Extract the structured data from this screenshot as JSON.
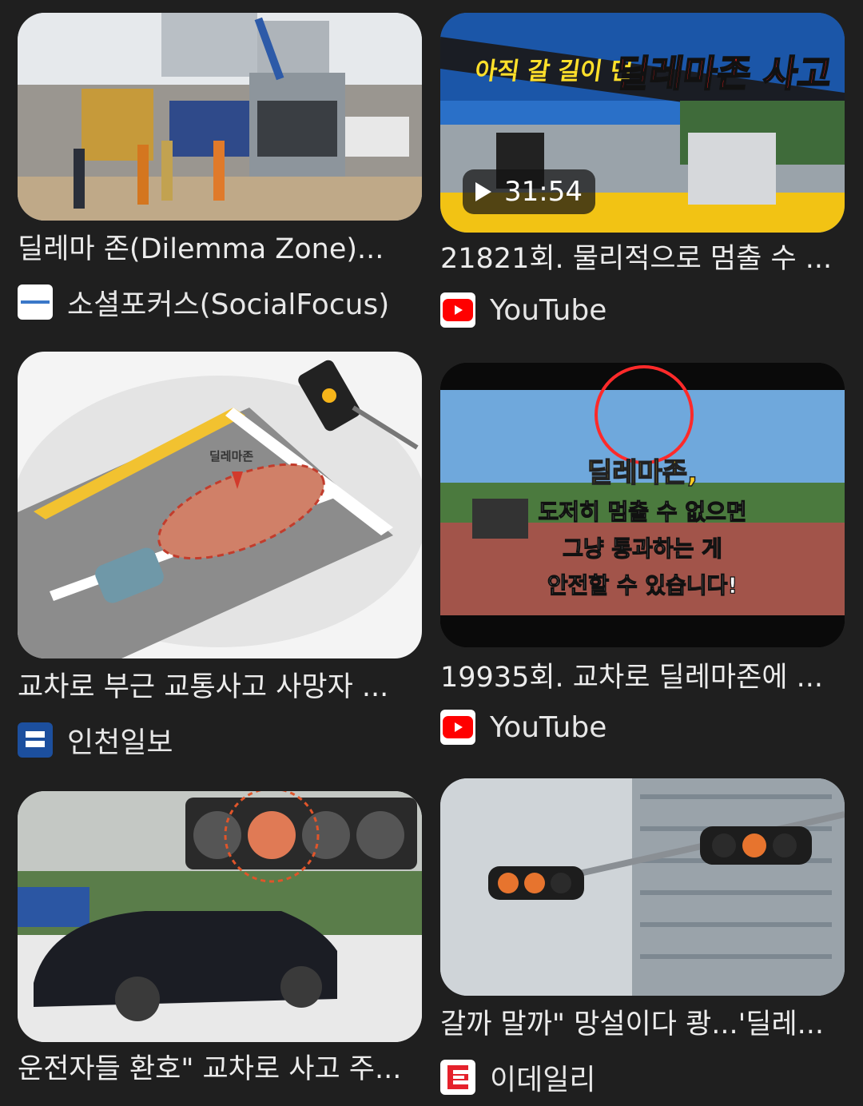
{
  "results": [
    {
      "title": "딜레마 존(Dilemma Zone)...",
      "source": "소셜포커스(SocialFocus)",
      "favicon": "socialfocus-favicon"
    },
    {
      "title": "21821회. 물리적으로 멈출 수 ...",
      "source": "YouTube",
      "favicon": "youtube-icon",
      "duration": "31:54",
      "overlay_text_white": "아직 갈 길이 먼",
      "overlay_text_red": "딜레마존 사고"
    },
    {
      "title": "교차로 부근 교통사고 사망자 ...",
      "source": "인천일보",
      "favicon": "incheon-ilbo-favicon",
      "diagram_label": "딜레마존"
    },
    {
      "title": "19935회. 교차로 딜레마존에 ...",
      "source": "YouTube",
      "favicon": "youtube-icon",
      "overlay_lines": [
        "딜레마존,",
        "도저히 멈출 수 없으면",
        "그냥 통과하는 게",
        "안전할 수 있습니다!"
      ]
    },
    {
      "title": "운전자들 환호\" 교차로 사고 주...",
      "source": "",
      "favicon": ""
    },
    {
      "title": "갈까 말까\" 망설이다 쾅...'딜레...",
      "source": "이데일리",
      "favicon": "edaily-favicon"
    }
  ],
  "colors": {
    "background": "#1f1f1f",
    "youtube_red": "#ff0000",
    "edaily_red": "#e5212b"
  }
}
